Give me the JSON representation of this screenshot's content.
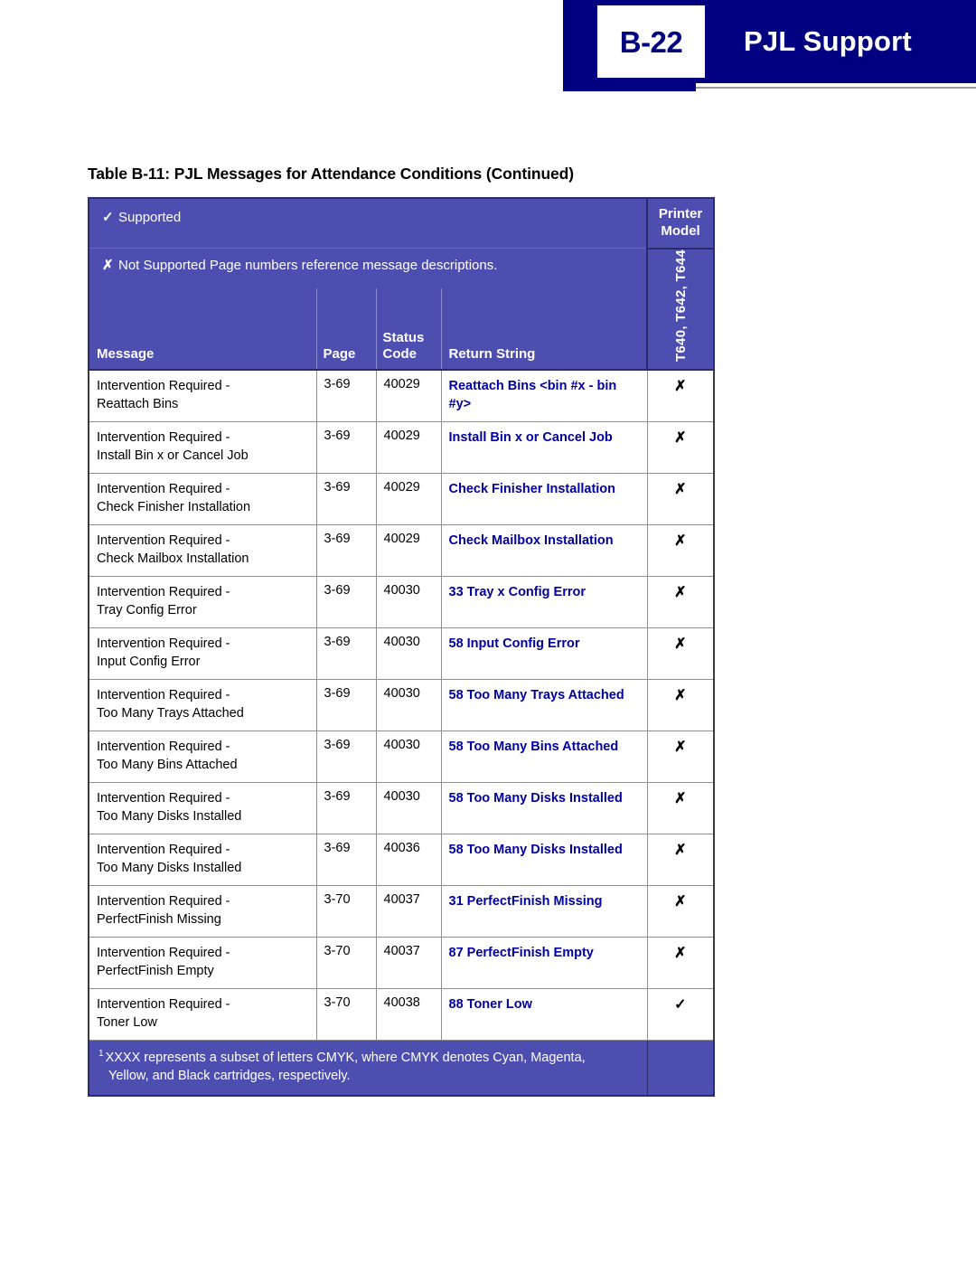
{
  "header": {
    "page_chip": "B-22",
    "title": "PJL Support"
  },
  "table": {
    "caption": "Table B-11:  PJL Messages for Attendance Conditions (Continued)",
    "legend": {
      "supported_mark": "✓",
      "supported_label": "Supported",
      "not_supported_mark": "✗",
      "not_supported_label": "Not Supported",
      "note": "Page numbers reference message descriptions."
    },
    "model_header": {
      "line1": "Printer",
      "line2": "Model",
      "vertical_label": "T640, T642, T644"
    },
    "columns": {
      "message": "Message",
      "page": "Page",
      "status_line1": "Status",
      "status_line2": "Code",
      "return_string": "Return String"
    },
    "rows": [
      {
        "message_line1": "Intervention Required -",
        "message_line2": "Reattach Bins",
        "page": "3-69",
        "status_code": "40029",
        "return_string": "Reattach Bins <bin #x - bin #y>",
        "model": "✗"
      },
      {
        "message_line1": "Intervention Required -",
        "message_line2": "Install Bin x or Cancel Job",
        "page": "3-69",
        "status_code": "40029",
        "return_string": "Install Bin x or Cancel Job",
        "model": "✗"
      },
      {
        "message_line1": "Intervention Required -",
        "message_line2": "Check Finisher Installation",
        "page": "3-69",
        "status_code": "40029",
        "return_string": "Check Finisher Installation",
        "model": "✗"
      },
      {
        "message_line1": "Intervention Required -",
        "message_line2": "Check Mailbox Installation",
        "page": "3-69",
        "status_code": "40029",
        "return_string": "Check Mailbox Installation",
        "model": "✗"
      },
      {
        "message_line1": "Intervention Required -",
        "message_line2": "Tray Config Error",
        "page": "3-69",
        "status_code": "40030",
        "return_string": "33 Tray x Config Error",
        "model": "✗"
      },
      {
        "message_line1": "Intervention Required -",
        "message_line2": "Input Config Error",
        "page": "3-69",
        "status_code": "40030",
        "return_string": "58 Input Config Error",
        "model": "✗"
      },
      {
        "message_line1": "Intervention Required -",
        "message_line2": "Too Many Trays Attached",
        "page": "3-69",
        "status_code": "40030",
        "return_string": "58 Too Many Trays Attached",
        "model": "✗"
      },
      {
        "message_line1": "Intervention Required -",
        "message_line2": "Too Many Bins Attached",
        "page": "3-69",
        "status_code": "40030",
        "return_string": "58 Too Many Bins Attached",
        "model": "✗"
      },
      {
        "message_line1": "Intervention Required -",
        "message_line2": "Too Many Disks Installed",
        "page": "3-69",
        "status_code": "40030",
        "return_string": "58 Too Many Disks Installed",
        "model": "✗"
      },
      {
        "message_line1": "Intervention Required -",
        "message_line2": "Too Many Disks Installed",
        "page": "3-69",
        "status_code": "40036",
        "return_string": "58 Too Many Disks Installed",
        "model": "✗"
      },
      {
        "message_line1": "Intervention Required -",
        "message_line2": "PerfectFinish Missing",
        "page": "3-70",
        "status_code": "40037",
        "return_string": "31 PerfectFinish Missing",
        "model": "✗"
      },
      {
        "message_line1": "Intervention Required -",
        "message_line2": "PerfectFinish Empty",
        "page": "3-70",
        "status_code": "40037",
        "return_string": "87 PerfectFinish Empty",
        "model": "✗"
      },
      {
        "message_line1": "Intervention Required -",
        "message_line2": "Toner Low",
        "page": "3-70",
        "status_code": "40038",
        "return_string": "88 Toner Low",
        "model": "✓"
      }
    ],
    "footnote": {
      "marker": "1",
      "line1": "XXXX represents a subset of letters CMYK, where CMYK denotes Cyan, Magenta,",
      "line2": "Yellow, and Black cartridges, respectively."
    }
  },
  "colors": {
    "header_band": "#000080",
    "table_header_bg": "#4e4eb0",
    "return_string_text": "#0000a0"
  }
}
